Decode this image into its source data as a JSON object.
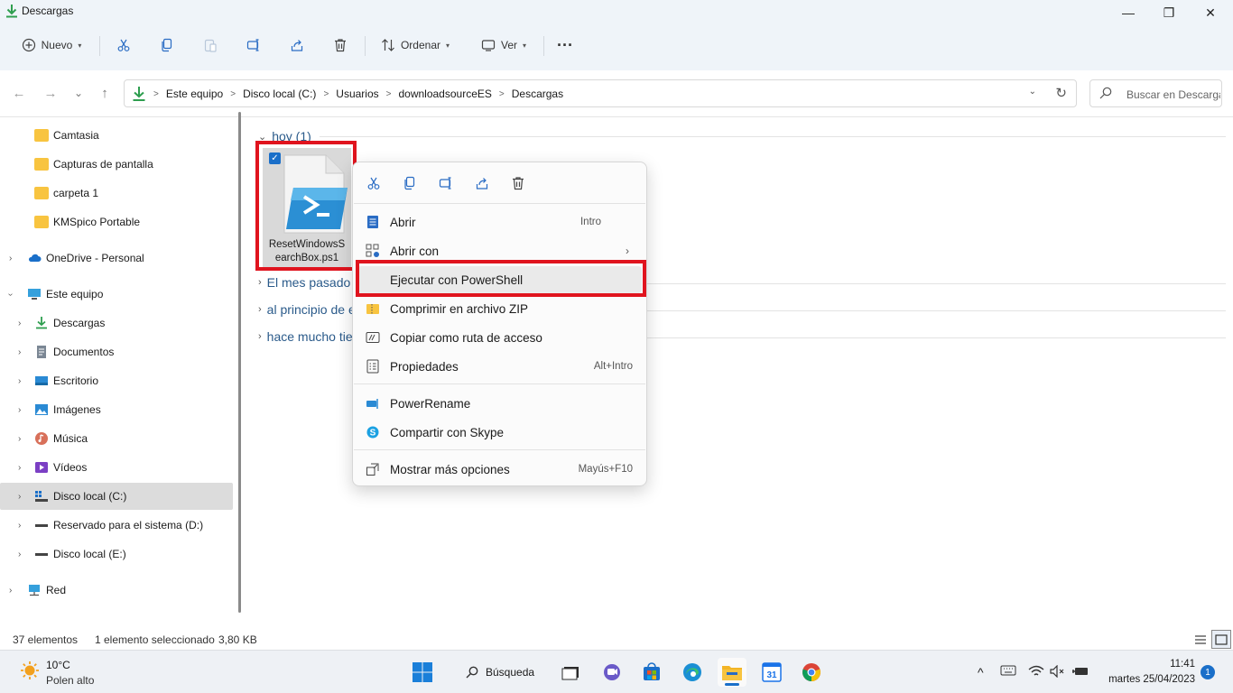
{
  "window": {
    "title": "Descargas",
    "minimize_glyph": "—",
    "maximize_glyph": "❐",
    "close_glyph": "✕"
  },
  "toolbar": {
    "new_label": "Nuevo",
    "sort_label": "Ordenar",
    "view_label": "Ver",
    "more_glyph": "···",
    "icons": [
      "scissors-icon",
      "copy-icon",
      "paste-icon",
      "rename-icon",
      "share-icon",
      "trash-icon"
    ]
  },
  "navigation": {
    "back_glyph": "←",
    "forward_glyph": "→",
    "recent_glyph": "⌄",
    "up_glyph": "↑",
    "breadcrumbs": [
      "Este equipo",
      "Disco local (C:)",
      "Usuarios",
      "downloadsourceES",
      "Descargas"
    ],
    "crumb_separator": ">",
    "dropdown_glyph": "⌄",
    "refresh_glyph": "↻",
    "search_placeholder": "Buscar en Descargas"
  },
  "sidebar": {
    "items": [
      {
        "label": "Camtasia",
        "icon": "folder-icon",
        "expandable": false
      },
      {
        "label": "Capturas de pantalla",
        "icon": "folder-icon",
        "expandable": false
      },
      {
        "label": "carpeta 1",
        "icon": "folder-icon",
        "expandable": false
      },
      {
        "label": "KMSpico Portable",
        "icon": "folder-icon",
        "expandable": false
      },
      {
        "label": "OneDrive - Personal",
        "icon": "cloud-icon",
        "expandable": true
      },
      {
        "label": "Este equipo",
        "icon": "computer-icon",
        "expandable": true,
        "expanded": true
      },
      {
        "label": "Descargas",
        "icon": "download-icon",
        "expandable": true
      },
      {
        "label": "Documentos",
        "icon": "document-icon",
        "expandable": true
      },
      {
        "label": "Escritorio",
        "icon": "desktop-icon",
        "expandable": true
      },
      {
        "label": "Imágenes",
        "icon": "pictures-icon",
        "expandable": true
      },
      {
        "label": "Música",
        "icon": "music-icon",
        "expandable": true
      },
      {
        "label": "Vídeos",
        "icon": "videos-icon",
        "expandable": true
      },
      {
        "label": "Disco local (C:)",
        "icon": "drive-icon",
        "expandable": true,
        "selected": true
      },
      {
        "label": "Reservado para el sistema (D:)",
        "icon": "drive-icon",
        "expandable": true
      },
      {
        "label": "Disco local (E:)",
        "icon": "drive-icon",
        "expandable": true
      },
      {
        "label": "Red",
        "icon": "network-icon",
        "expandable": true
      }
    ]
  },
  "content": {
    "groups": [
      {
        "label": "hoy (1)",
        "expanded": true
      },
      {
        "label": "El mes pasado",
        "expanded": false
      },
      {
        "label": "al principio de este año",
        "expanded": false
      },
      {
        "label": "hace mucho tiempo",
        "expanded": false
      }
    ],
    "file": {
      "name": "ResetWindowsSearchBox.ps1",
      "checked": true,
      "icon": "powershell-script-icon"
    }
  },
  "context_menu": {
    "quick_actions": [
      "cut-icon",
      "copy-icon",
      "rename-icon",
      "share-icon",
      "delete-icon"
    ],
    "items": [
      {
        "label": "Abrir",
        "shortcut": "Intro",
        "icon": "open-icon"
      },
      {
        "label": "Abrir con",
        "shortcut": "",
        "icon": "open-with-icon",
        "submenu": true
      },
      {
        "label": "Ejecutar con PowerShell",
        "shortcut": "",
        "icon": "",
        "highlighted": true
      },
      {
        "label": "Comprimir en archivo ZIP",
        "shortcut": "",
        "icon": "zip-icon"
      },
      {
        "label": "Copiar como ruta de acceso",
        "shortcut": "",
        "icon": "copy-path-icon"
      },
      {
        "label": "Propiedades",
        "shortcut": "Alt+Intro",
        "icon": "properties-icon"
      },
      {
        "label": "PowerRename",
        "shortcut": "",
        "icon": "powerrename-icon"
      },
      {
        "label": "Compartir con Skype",
        "shortcut": "",
        "icon": "skype-icon"
      },
      {
        "label": "Mostrar más opciones",
        "shortcut": "Mayús+F10",
        "icon": "more-options-icon"
      }
    ],
    "submenu_glyph": "›"
  },
  "statusbar": {
    "count": "37 elementos",
    "selection": "1 elemento seleccionado",
    "size": "3,80 KB"
  },
  "taskbar": {
    "weather_temp": "10°C",
    "weather_desc": "Polen alto",
    "search_label": "Búsqueda",
    "apps": [
      "windows-start-icon",
      "task-view-icon",
      "chat-icon",
      "store-icon",
      "edge-icon",
      "file-explorer-icon",
      "calendar-icon",
      "chrome-icon"
    ],
    "calendar_day": "31",
    "time": "11:41",
    "date": "martes 25/04/2023",
    "notifications": "1",
    "tray": {
      "chevron": "^"
    }
  },
  "colors": {
    "accent": "#1a6fc9",
    "highlight_border": "#e0141e",
    "folder": "#f8c440",
    "chrome_bg": "#eff4f9"
  }
}
